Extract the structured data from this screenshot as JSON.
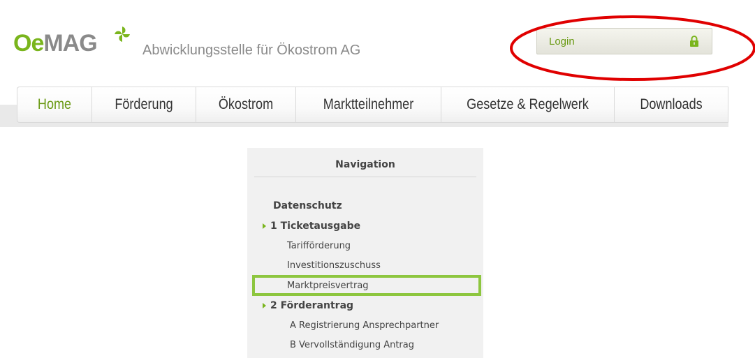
{
  "header": {
    "logo_oe": "Oe",
    "logo_mag": "MAG",
    "tagline": "Abwicklungsstelle für Ökostrom AG",
    "login_label": "Login",
    "login_icon": "lock-icon",
    "brand_green": "#7ab51d",
    "annotation_color": "#e00000"
  },
  "menu": {
    "items": [
      {
        "label": "Home",
        "active": true
      },
      {
        "label": "Förderung"
      },
      {
        "label": "Ökostrom"
      },
      {
        "label": "Marktteilnehmer"
      },
      {
        "label": "Gesetze & Regelwerk"
      },
      {
        "label": "Downloads"
      }
    ]
  },
  "navigation": {
    "title": "Navigation",
    "items": [
      {
        "label": "Datenschutz",
        "level": 0
      },
      {
        "label": "1 Ticketausgabe",
        "level": 0,
        "expandable": true
      },
      {
        "label": "Tarifförderung",
        "level": 1
      },
      {
        "label": "Investitionszuschuss",
        "level": 1
      },
      {
        "label": "Marktpreisvertrag",
        "level": 1,
        "highlighted": true
      },
      {
        "label": "2 Förderantrag",
        "level": 0,
        "expandable": true
      },
      {
        "label": "A Registrierung Ansprechpartner",
        "level": 1
      },
      {
        "label": "B Vervollständigung Antrag",
        "level": 1
      }
    ],
    "highlight_color": "#8dc63f"
  }
}
